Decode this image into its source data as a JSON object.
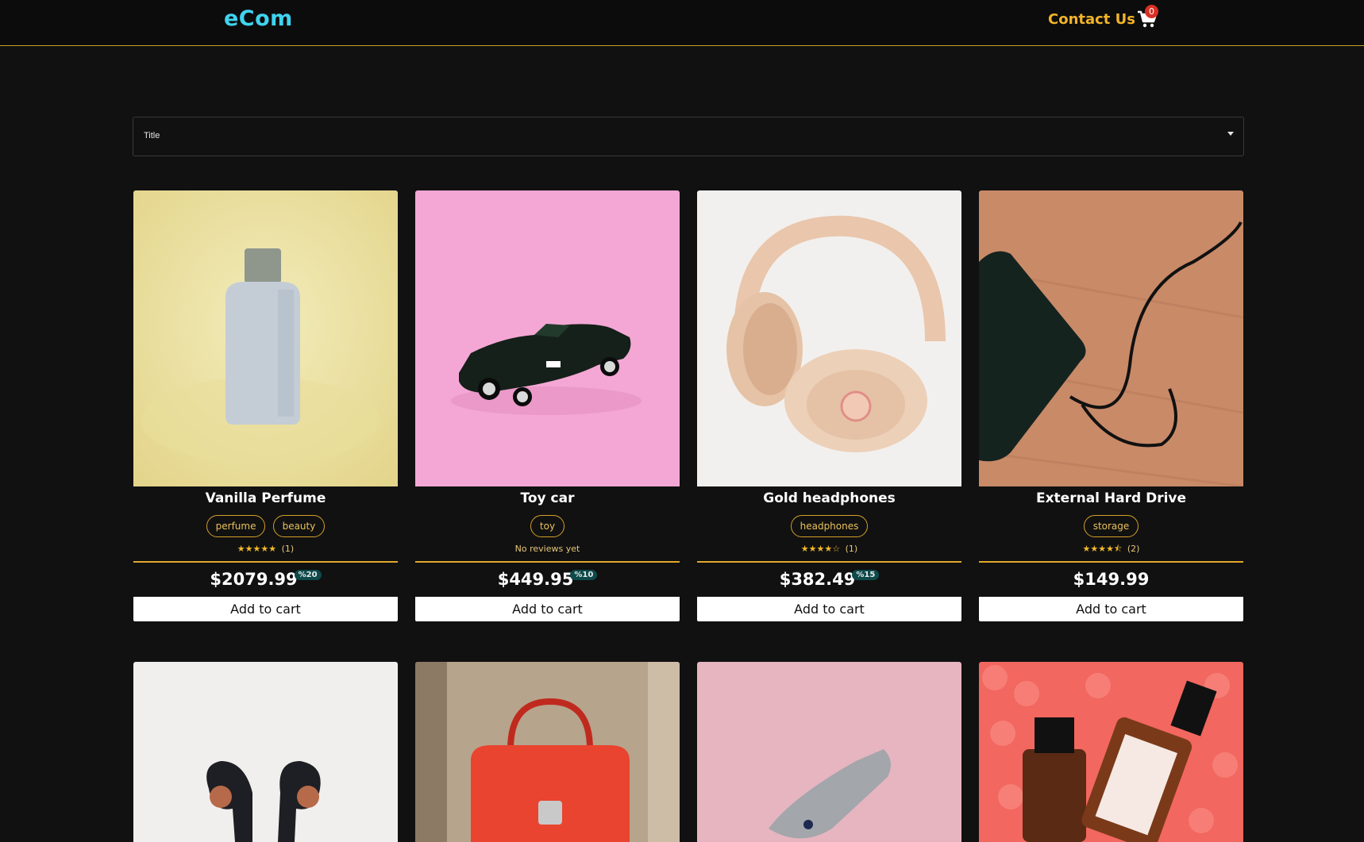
{
  "header": {
    "logo": "eCom",
    "contact_label": "Contact Us",
    "cart_count": "0",
    "cart_icon": "shopping-cart-icon"
  },
  "filter": {
    "label": "Title"
  },
  "add_to_cart_label": "Add to cart",
  "products": [
    {
      "title": "Vanilla Perfume",
      "tags": [
        "perfume",
        "beauty"
      ],
      "stars": "★★★★★",
      "rating": 5,
      "review_count": "(1)",
      "price": "$2079.99",
      "discount": "%20",
      "image": "perfume bottle"
    },
    {
      "title": "Toy car",
      "tags": [
        "toy"
      ],
      "no_reviews": "No reviews yet",
      "price": "$449.95",
      "discount": "%10",
      "image": "toy car"
    },
    {
      "title": "Gold headphones",
      "tags": [
        "headphones"
      ],
      "stars": "★★★★☆",
      "rating": 4,
      "review_count": "(1)",
      "price": "$382.49",
      "discount": "%15",
      "image": "headphones"
    },
    {
      "title": "External Hard Drive",
      "tags": [
        "storage"
      ],
      "stars": "★★★★⯪",
      "rating": 4.5,
      "review_count": "(2)",
      "price": "$149.99",
      "image": "hard drive"
    }
  ],
  "colors": {
    "accent": "#f0b429",
    "logo": "#3fd3f0",
    "background": "#111111",
    "discount_badge": "#0e4a4a"
  }
}
